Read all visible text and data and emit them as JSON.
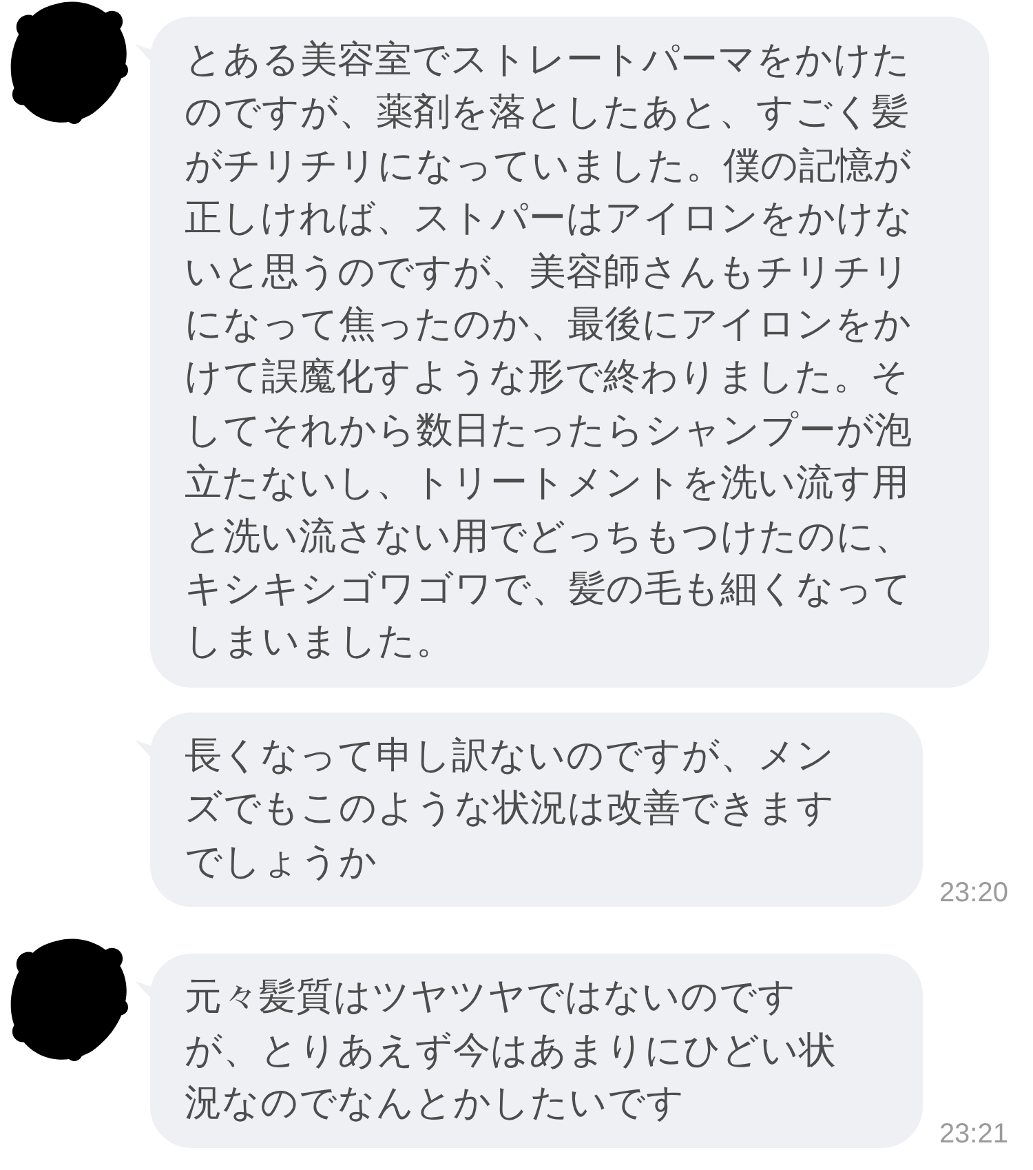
{
  "chat": {
    "groups": [
      {
        "messages": [
          {
            "text": "とある美容室でストレートパーマをかけたのですが、薬剤を落としたあと、すごく髪がチリチリになっていました。僕の記憶が正しければ、ストパーはアイロンをかけないと思うのですが、美容師さんもチリチリになって焦ったのか、最後にアイロンをかけて誤魔化すような形で終わりました。そしてそれから数日たったらシャンプーが泡立たないし、トリートメントを洗い流す用と洗い流さない用でどっちもつけたのに、キシキシゴワゴワで、髪の毛も細くなってしまいました。"
          },
          {
            "text": "長くなって申し訳ないのですが、メンズでもこのような状況は改善できますでしょうか",
            "time": "23:20"
          }
        ]
      },
      {
        "messages": [
          {
            "text": "元々髪質はツヤツヤではないのですが、とりあえず今はあまりにひどい状況なのでなんとかしたいです",
            "time": "23:21"
          }
        ]
      }
    ]
  }
}
